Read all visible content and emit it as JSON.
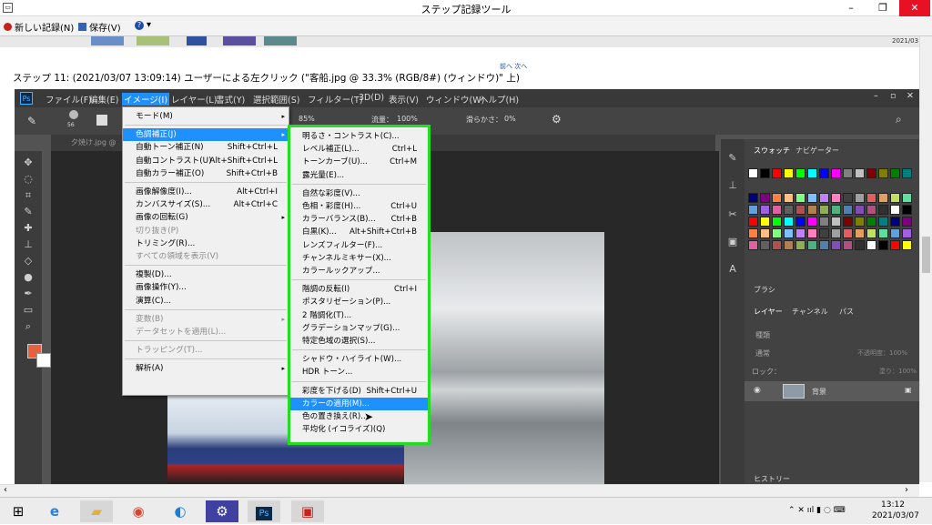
{
  "window": {
    "title": "ステップ記録ツール",
    "icon": "app-icon",
    "min": "–",
    "max": "❐",
    "close": "✕"
  },
  "toolbar": {
    "new_record": "新しい記録(N)",
    "save": "保存(V)",
    "help": "?",
    "help_arrow": "▾"
  },
  "nav": {
    "prev_next": "前へ 次へ"
  },
  "step": {
    "title": "ステップ 11: (2021/03/07 13:09:14) ユーザーによる左クリック (\"客船.jpg @ 33.3% (RGB/8#) (ウィンドウ)\" 上)"
  },
  "thumb_time": "2021/03",
  "ps": {
    "logo": "Ps",
    "menus": [
      "ファイル(F)",
      "編集(E)",
      "イメージ(I)",
      "レイヤー(L)",
      "書式(Y)",
      "選択範囲(S)",
      "フィルター(T)",
      "3D(D)",
      "表示(V)",
      "ウィンドウ(W)",
      "ヘルプ(H)"
    ],
    "options": {
      "brush_size": "56",
      "opacity_pct": "85%",
      "flow_label": "流量：",
      "flow": "100%",
      "smooth_label": "滑らかさ：",
      "smooth": "0%"
    },
    "doc_tab": "夕焼け.jpg @",
    "panels": {
      "tab_swatches": "スウォッチ",
      "tab_navigator": "ナビゲーター",
      "brush": "ブラシ",
      "tab_layers": "レイヤー",
      "tab_channels": "チャンネル",
      "tab_paths": "パス",
      "kind": "種類",
      "blend": "通常",
      "opacity": "不透明度：100%",
      "lock": "ロック：",
      "fill": "塗り：100%",
      "layer_name": "背景",
      "history": "ヒストリー"
    }
  },
  "menu1": {
    "items": [
      {
        "label": "モード(M)",
        "arrow": "▸"
      },
      {
        "label": "色調補正(J)",
        "arrow": "▸",
        "highlight": true
      },
      {
        "label": "自動トーン補正(N)",
        "shortcut": "Shift+Ctrl+L"
      },
      {
        "label": "自動コントラスト(U)",
        "shortcut": "Alt+Shift+Ctrl+L"
      },
      {
        "label": "自動カラー補正(O)",
        "shortcut": "Shift+Ctrl+B"
      },
      {
        "label": "画像解像度(I)...",
        "shortcut": "Alt+Ctrl+I"
      },
      {
        "label": "カンバスサイズ(S)...",
        "shortcut": "Alt+Ctrl+C"
      },
      {
        "label": "画像の回転(G)",
        "arrow": "▸"
      },
      {
        "label": "切り抜き(P)",
        "disabled": true
      },
      {
        "label": "トリミング(R)..."
      },
      {
        "label": "すべての領域を表示(V)",
        "disabled": true
      },
      {
        "label": "複製(D)..."
      },
      {
        "label": "画像操作(Y)..."
      },
      {
        "label": "演算(C)..."
      },
      {
        "label": "変数(B)",
        "arrow": "▸",
        "disabled": true
      },
      {
        "label": "データセットを適用(L)...",
        "disabled": true
      },
      {
        "label": "トラッピング(T)...",
        "disabled": true
      },
      {
        "label": "解析(A)",
        "arrow": "▸"
      }
    ]
  },
  "menu2": {
    "items": [
      {
        "label": "明るさ・コントラスト(C)..."
      },
      {
        "label": "レベル補正(L)...",
        "shortcut": "Ctrl+L"
      },
      {
        "label": "トーンカーブ(U)...",
        "shortcut": "Ctrl+M"
      },
      {
        "label": "露光量(E)..."
      },
      {
        "label": "自然な彩度(V)..."
      },
      {
        "label": "色相・彩度(H)...",
        "shortcut": "Ctrl+U"
      },
      {
        "label": "カラーバランス(B)...",
        "shortcut": "Ctrl+B"
      },
      {
        "label": "白黒(K)...",
        "shortcut": "Alt+Shift+Ctrl+B"
      },
      {
        "label": "レンズフィルター(F)..."
      },
      {
        "label": "チャンネルミキサー(X)..."
      },
      {
        "label": "カラールックアップ..."
      },
      {
        "label": "階調の反転(I)",
        "shortcut": "Ctrl+I"
      },
      {
        "label": "ポスタリゼーション(P)..."
      },
      {
        "label": "2 階調化(T)..."
      },
      {
        "label": "グラデーションマップ(G)..."
      },
      {
        "label": "特定色域の選択(S)..."
      },
      {
        "label": "シャドウ・ハイライト(W)..."
      },
      {
        "label": "HDR トーン..."
      },
      {
        "label": "彩度を下げる(D)",
        "shortcut": "Shift+Ctrl+U"
      },
      {
        "label": "カラーの適用(M)...",
        "highlight": true
      },
      {
        "label": "色の置き換え(R)..."
      },
      {
        "label": "平均化 (イコライズ)(Q)"
      }
    ]
  },
  "taskbar": {
    "time": "13:12",
    "date": "2021/03/07",
    "apps": [
      "start-icon",
      "ie-icon",
      "explorer-icon",
      "chrome-icon",
      "edge-icon",
      "settings-icon",
      "photoshop-icon",
      "steps-recorder-icon"
    ],
    "ps_label": "Ps"
  },
  "colors": {
    "highlight": "#1e90ff",
    "green_frame": "#22dd22",
    "ps_bg": "#535353"
  }
}
